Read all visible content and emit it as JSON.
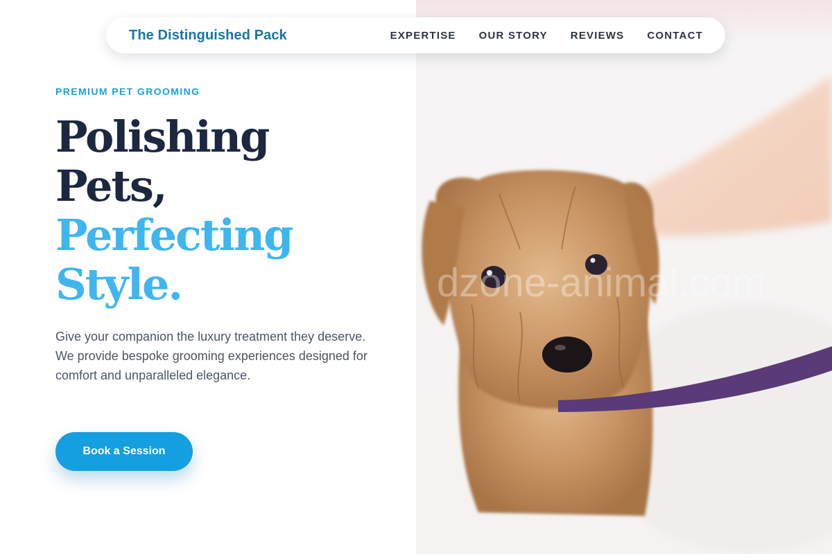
{
  "nav": {
    "brand": "The Distinguished Pack",
    "links": [
      "EXPERTISE",
      "OUR STORY",
      "REVIEWS",
      "CONTACT"
    ]
  },
  "hero": {
    "eyebrow": "PREMIUM PET GROOMING",
    "headline_lines": [
      "Polishing",
      "Pets,",
      "Perfecting",
      "Style."
    ],
    "lead": "Give your companion the luxury treatment they deserve. We provide bespoke grooming experiences designed for comfort and unparalleled elegance.",
    "cta_label": "Book a Session"
  },
  "photo": {
    "subject": "wet-dog-on-leash-icon",
    "watermark": "dzone-animal.com"
  },
  "colors": {
    "brand": "#1676a6",
    "accent": "#139fe0",
    "headline_dark": "#1c2740",
    "headline_blue": "#3fb6ef",
    "leash": "#5a3a78"
  }
}
